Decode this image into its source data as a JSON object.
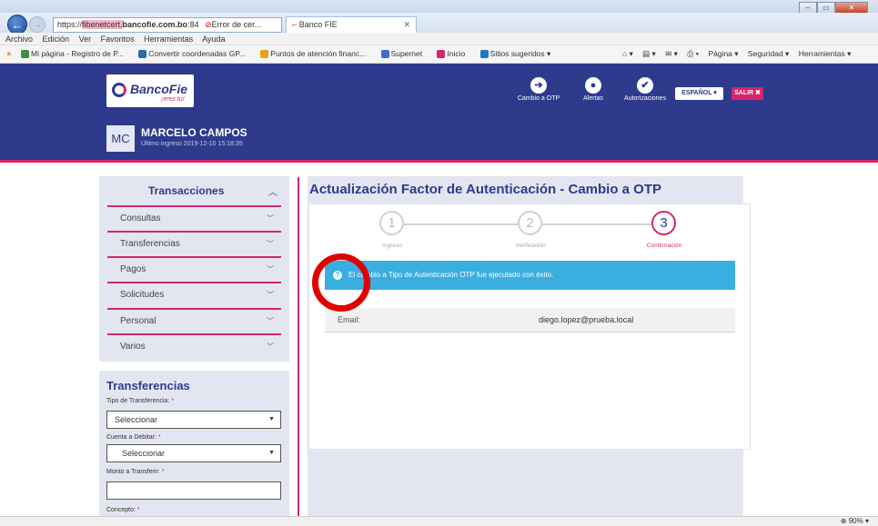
{
  "browser": {
    "url_prefix": "https://",
    "url_domain_hl": "fibenetcert.",
    "url_domain": "bancofie.com.bo",
    "url_rest": ":84",
    "cert_error": "Error de cer...",
    "tab_title": "Banco FIE",
    "menu": [
      "Archivo",
      "Edición",
      "Ver",
      "Favoritos",
      "Herramientas",
      "Ayuda"
    ],
    "favorites": [
      "Mi página - Registro de P...",
      "Convertir coordenadas GP...",
      "Puntos de atención financ...",
      "Supernet",
      "Inicio",
      "Sitios sugeridos ▾"
    ],
    "fav_colors": [
      "#3a8f3a",
      "#2b6cb0",
      "#e5a31b",
      "#3a6ec4",
      "#d6246e",
      "#1e78c8"
    ],
    "toolbar_right": [
      "Página ▾",
      "Seguridad ▾",
      "Herramientas ▾"
    ],
    "zoom": "90%"
  },
  "header": {
    "logo_name": "BancoFie",
    "logo_tag": "¡eres tú!",
    "user_initials": "MC",
    "user_name": "MARCELO CAMPOS",
    "last_login": "Último ingreso 2019-12-10 15:18:35",
    "icons": [
      {
        "label": "Cambio a OTP",
        "glyph": "➔"
      },
      {
        "label": "Alertas",
        "glyph": "🔔"
      },
      {
        "label": "Autorizaciones",
        "glyph": "✔"
      }
    ],
    "language": "ESPAÑOL ▾",
    "logout": "SALIR ✖"
  },
  "sidebar": {
    "title": "Transacciones",
    "items": [
      "Consultas",
      "Transferencias",
      "Pagos",
      "Solicitudes",
      "Personal",
      "Varios"
    ]
  },
  "transfer_form": {
    "title": "Transferencias",
    "tipo_label": "Tipo de Transferencia:",
    "tipo_value": "Seleccionar",
    "cuenta_label": "Cuenta a Debitar:",
    "cuenta_value": "Seleccionar",
    "monto_label": "Monto a Transferir:",
    "concepto_label": "Concepto:",
    "required_mark": "*"
  },
  "main": {
    "title": "Actualización Factor de Autenticación - Cambio a OTP",
    "steps": [
      {
        "num": "1",
        "label": "Ingreso"
      },
      {
        "num": "2",
        "label": "Verificación"
      },
      {
        "num": "3",
        "label": "Confirmación"
      }
    ],
    "alert": "El cambio a Tipo de Autenticación OTP fue ejecutado con éxito.",
    "email_label": "Email:",
    "email_value": "diego.lopez@prueba.local"
  }
}
